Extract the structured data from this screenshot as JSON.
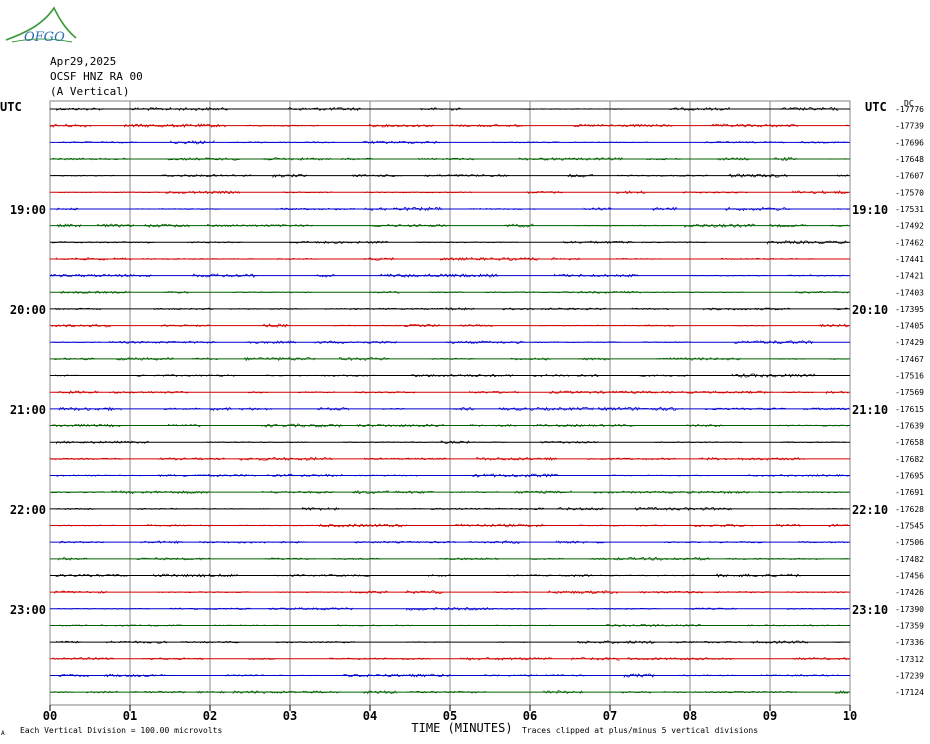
{
  "header": {
    "date": "Apr29,2025",
    "station": "OCSF HNZ RA 00",
    "component": "(A Vertical)",
    "logo_text": "OFGO"
  },
  "chart_data": {
    "type": "line",
    "title": "",
    "left_axis_label": "UTC",
    "right_axis_label": "UTC",
    "right_top_label": "DC",
    "xlabel": "TIME (MINUTES)",
    "x_ticks": [
      "00",
      "01",
      "02",
      "03",
      "04",
      "05",
      "06",
      "07",
      "08",
      "09",
      "10"
    ],
    "xlim": [
      0,
      10
    ],
    "left_hour_labels": [
      {
        "label": "19:00",
        "trace_index": 6
      },
      {
        "label": "20:00",
        "trace_index": 12
      },
      {
        "label": "21:00",
        "trace_index": 18
      },
      {
        "label": "22:00",
        "trace_index": 24
      },
      {
        "label": "23:00",
        "trace_index": 30
      }
    ],
    "right_hour_labels": [
      {
        "label": "19:10",
        "trace_index": 6
      },
      {
        "label": "20:10",
        "trace_index": 12
      },
      {
        "label": "21:10",
        "trace_index": 18
      },
      {
        "label": "22:10",
        "trace_index": 24
      },
      {
        "label": "23:10",
        "trace_index": 30
      }
    ],
    "trace_colors": [
      "#000000",
      "#d00000",
      "#0000d0",
      "#006000"
    ],
    "trace_offsets": [
      -17776,
      -17739,
      -17696,
      -17648,
      -17607,
      -17570,
      -17531,
      -17492,
      -17462,
      -17441,
      -17421,
      -17403,
      -17395,
      -17405,
      -17429,
      -17467,
      -17516,
      -17569,
      -17615,
      -17639,
      -17658,
      -17682,
      -17695,
      -17691,
      -17628,
      -17545,
      -17506,
      -17482,
      -17456,
      -17426,
      -17390,
      -17359,
      -17336,
      -17312,
      -17239,
      -17124
    ],
    "footer_left": "Each Vertical Division =  100.00 microvolts",
    "footer_right": "Traces clipped at plus/minus 5 vertical divisions",
    "footer_mark": "A"
  }
}
